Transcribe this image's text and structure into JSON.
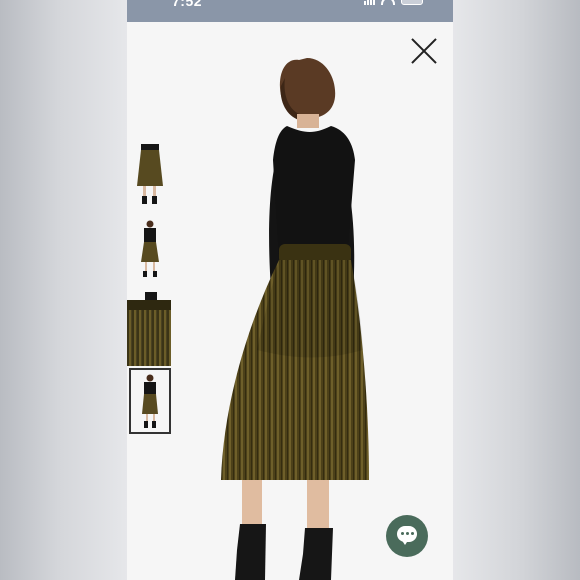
{
  "status_bar": {
    "time": "7:52",
    "icons": [
      "signal-icon",
      "wifi-icon",
      "battery-icon"
    ]
  },
  "overlay": {
    "close_icon": "close-icon"
  },
  "gallery": {
    "thumbnails": [
      {
        "name": "thumb-skirt-closeup-1",
        "selected": false
      },
      {
        "name": "thumb-model-front",
        "selected": false
      },
      {
        "name": "thumb-model-side",
        "selected": false
      },
      {
        "name": "thumb-model-back",
        "selected": true
      },
      {
        "name": "thumb-fabric-detail",
        "selected": false
      }
    ],
    "main_image": "model-back-view"
  },
  "chat": {
    "icon": "chat-icon"
  },
  "colors": {
    "status_bar": "#8a96a8",
    "skirt": "#574a20",
    "top": "#121212",
    "chat_button": "#4a6b5b"
  }
}
